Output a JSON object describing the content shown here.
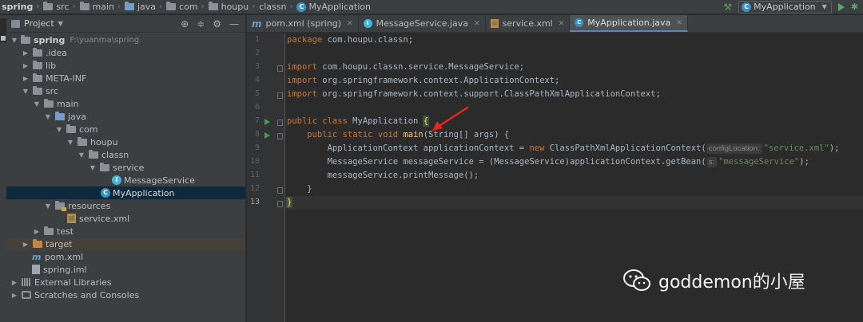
{
  "breadcrumb": [
    "spring",
    "src",
    "main",
    "java",
    "com",
    "houpu",
    "classn",
    "MyApplication"
  ],
  "run": {
    "config_label": "MyApplication"
  },
  "project_panel": {
    "title": "Project",
    "tree": [
      {
        "label": "spring",
        "path": "F:\\yuanma\\spring",
        "icon": "module-folder-icon"
      },
      {
        "label": ".idea",
        "icon": "folder-icon"
      },
      {
        "label": "lib",
        "icon": "folder-icon"
      },
      {
        "label": "META-INF",
        "icon": "folder-icon"
      },
      {
        "label": "src",
        "icon": "folder-icon"
      },
      {
        "label": "main",
        "icon": "folder-icon"
      },
      {
        "label": "java",
        "icon": "source-folder-icon"
      },
      {
        "label": "com",
        "icon": "package-icon"
      },
      {
        "label": "houpu",
        "icon": "package-icon"
      },
      {
        "label": "classn",
        "icon": "package-icon"
      },
      {
        "label": "service",
        "icon": "package-icon"
      },
      {
        "label": "MessageService",
        "icon": "interface-icon"
      },
      {
        "label": "MyApplication",
        "icon": "class-icon"
      },
      {
        "label": "resources",
        "icon": "resources-folder-icon"
      },
      {
        "label": "service.xml",
        "icon": "xml-file-icon"
      },
      {
        "label": "test",
        "icon": "folder-icon"
      },
      {
        "label": "target",
        "icon": "excluded-folder-icon"
      },
      {
        "label": "pom.xml",
        "icon": "maven-icon"
      },
      {
        "label": "spring.iml",
        "icon": "iml-file-icon"
      },
      {
        "label": "External Libraries",
        "icon": "libraries-icon"
      },
      {
        "label": "Scratches and Consoles",
        "icon": "scratches-icon"
      }
    ]
  },
  "tabs": [
    {
      "label": "pom.xml (spring)",
      "icon": "maven-icon"
    },
    {
      "label": "MessageService.java",
      "icon": "interface-icon"
    },
    {
      "label": "service.xml",
      "icon": "xml-file-icon"
    },
    {
      "label": "MyApplication.java",
      "icon": "class-icon"
    }
  ],
  "editor": {
    "line_numbers": [
      "1",
      "2",
      "3",
      "4",
      "5",
      "6",
      "7",
      "8",
      "9",
      "10",
      "11",
      "12",
      "13"
    ],
    "current_line": "13",
    "hints": {
      "config_location": "configLocation:",
      "s": "s:"
    },
    "code": {
      "l1_kw": "package",
      "l1_rest": " com.houpu.classn;",
      "l3_kw": "import",
      "l3_rest": " com.houpu.classn.service.MessageService;",
      "l4_kw": "import",
      "l4_rest": " org.springframework.context.ApplicationContext;",
      "l5_kw": "import",
      "l5_rest": " org.springframework.context.support.ClassPathXmlApplicationContext;",
      "l7_kw": "public class",
      "l7_rest": " MyApplication ",
      "l7_brace": "{",
      "l8_indent": "    ",
      "l8_kw": "public static void",
      "l8_sp": " ",
      "l8_meth": "main",
      "l8_rest": "(String[] args) {",
      "l9_indent": "        ",
      "l9_a": "ApplicationContext applicationContext = ",
      "l9_kw": "new",
      "l9_b": " ClassPathXmlApplicationContext(",
      "l9_str": "\"service.xml\"",
      "l9_end": ");",
      "l10_indent": "        ",
      "l10_a": "MessageService messageService = (MessageService)applicationContext.getBean(",
      "l10_str": "\"messageService\"",
      "l10_end": ");",
      "l11_indent": "        ",
      "l11_a": "messageService.printMessage();",
      "l12_indent": "    ",
      "l12_a": "}",
      "l13_a": "}"
    }
  },
  "watermark": {
    "text": "goddemon的小屋",
    "icon": "wechat-icon"
  },
  "colors": {
    "keyword": "#cc7832",
    "string": "#6a8759",
    "method": "#ffc66d",
    "plain": "#a9b7c6",
    "arrow": "#e8261b"
  }
}
